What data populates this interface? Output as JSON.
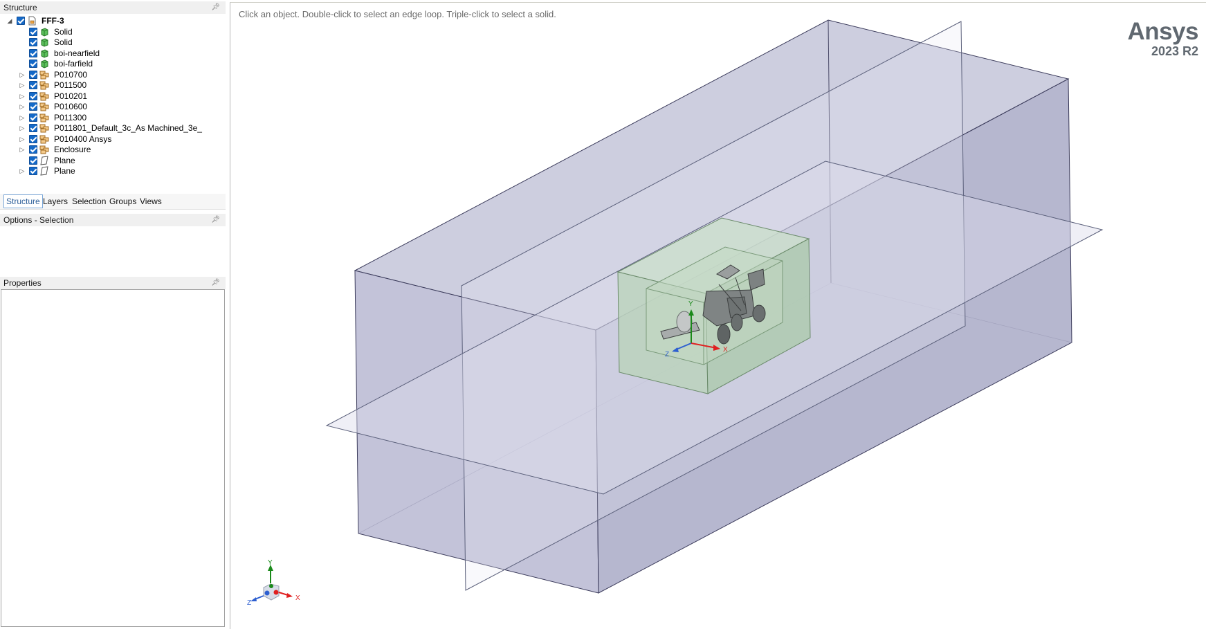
{
  "structure_panel": {
    "title": "Structure",
    "tree": [
      {
        "label": "FFF-3",
        "icon": "document-icon",
        "expandable": true,
        "expanded": true,
        "checked": true,
        "bold": true
      },
      {
        "label": "Solid",
        "icon": "solid-body-icon",
        "expandable": false,
        "checked": true
      },
      {
        "label": "Solid",
        "icon": "solid-body-icon",
        "expandable": false,
        "checked": true
      },
      {
        "label": "boi-nearfield",
        "icon": "solid-body-icon",
        "expandable": false,
        "checked": true
      },
      {
        "label": "boi-farfield",
        "icon": "solid-body-icon",
        "expandable": false,
        "checked": true
      },
      {
        "label": "P010700",
        "icon": "component-icon",
        "expandable": true,
        "checked": true
      },
      {
        "label": "P011500",
        "icon": "component-icon",
        "expandable": true,
        "checked": true
      },
      {
        "label": "P010201",
        "icon": "component-icon",
        "expandable": true,
        "checked": true
      },
      {
        "label": "P010600",
        "icon": "component-icon",
        "expandable": true,
        "checked": true
      },
      {
        "label": "P011300",
        "icon": "component-icon",
        "expandable": true,
        "checked": true
      },
      {
        "label": "P011801_Default_3c_As Machined_3e_",
        "icon": "component-icon",
        "expandable": true,
        "checked": true
      },
      {
        "label": "P010400 Ansys",
        "icon": "component-icon",
        "expandable": true,
        "checked": true
      },
      {
        "label": "Enclosure",
        "icon": "component-icon",
        "expandable": true,
        "checked": true
      },
      {
        "label": "Plane",
        "icon": "plane-icon",
        "expandable": false,
        "checked": true
      },
      {
        "label": "Plane",
        "icon": "plane-icon",
        "expandable": true,
        "checked": true
      }
    ]
  },
  "tabs": [
    {
      "label": "Structure",
      "active": true
    },
    {
      "label": "Layers",
      "active": false
    },
    {
      "label": "Selection",
      "active": false
    },
    {
      "label": "Groups",
      "active": false
    },
    {
      "label": "Views",
      "active": false
    }
  ],
  "options_panel": {
    "title": "Options - Selection"
  },
  "properties_panel": {
    "title": "Properties"
  },
  "viewport": {
    "hint": "Click an object. Double-click to select an edge loop. Triple-click to select a solid.",
    "brand_name": "Ansys",
    "brand_version": "2023 R2",
    "axis_labels": {
      "x": "X",
      "y": "Y",
      "z": "Z"
    }
  },
  "colors": {
    "checkbox": "#1569c7",
    "enclosure_fill": "#9fa2c4",
    "inner_box_fill": "#b5d2b5",
    "axis_x": "#e02020",
    "axis_y": "#1a8a1a",
    "axis_z": "#2d5fd0"
  }
}
